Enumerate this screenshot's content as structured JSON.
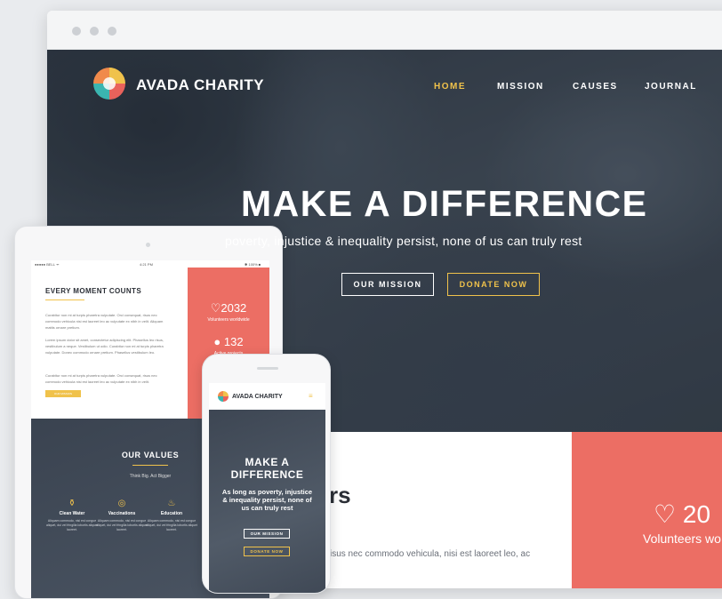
{
  "desktop": {
    "brand": "AVADA CHARITY",
    "nav": [
      "HOME",
      "MISSION",
      "CAUSES",
      "JOURNAL"
    ],
    "hero": {
      "title": "MAKE A DIFFERENCE",
      "subtitle": "poverty, injustice & inequality persist, none of us can truly rest",
      "btn_mission": "OUR MISSION",
      "btn_donate": "DONATE NOW"
    },
    "below": {
      "partial_heading": "rs",
      "partial_body": "isus nec commodo vehicula, nisi est laoreet leo, ac",
      "stat_value": "♡ 20",
      "stat_label": "Volunteers wo"
    }
  },
  "tablet": {
    "status_left": "●●●●● BELL ᯤ",
    "status_time": "4:21 PM",
    "status_right": "✱ 100% ■",
    "section_title": "EVERY MOMENT COUNTS",
    "para1": "Curabitur non mi at turpis pharetra vulputate. Orci consequat, risus nec commodo vehicula nisi est laoreet leo ac vulputate ex nibh in velit. Aliquam mattis ornare pretium.",
    "para2": "Lorem ipsum dolor sit amet, consectetur adipiscing elit. Phasellus leo risus, vestibulum a neque. Vestibulum ut odio. Curabitur non mi at turpis pharetra vulputate. Donec commodo ornare pretium. Phasellus vestibulum leo.",
    "para3": "Curabitur non mi at turpis pharetra vulputate. Orci consequat, risus nec commodo vehicula nisi est laoreet leo ac vulputate ex nibh in velit.",
    "button": "OUR MISSION",
    "stat1_value": "♡2032",
    "stat1_label": "Volunteers worldwide",
    "stat2_value": "132",
    "stat2_label": "Active projects",
    "values_title": "OUR VALUES",
    "values_sub": "Think Big. Act Bigger",
    "values": [
      {
        "icon": "⚱",
        "label": "Clean Water",
        "text": "Aliquam commodo, nisi est congue aliquet, dui vel fringilla lobortis aliquet laoreet."
      },
      {
        "icon": "◎",
        "label": "Vaccinations",
        "text": "Aliquam commodo, nisi est congue aliquet, dui vel fringilla lobortis aliquet laoreet."
      },
      {
        "icon": "♨",
        "label": "Education",
        "text": "Aliquam commodo, nisi est congue aliquet, dui vel fringilla lobortis aliquet laoreet."
      }
    ]
  },
  "phone": {
    "brand": "AVADA CHARITY",
    "menu_icon": "≡",
    "hero_title": "MAKE A DIFFERENCE",
    "hero_sub": "As long as poverty, injustice & inequality persist, none of us can truly rest",
    "btn_mission": "OUR MISSION",
    "btn_donate": "DONATE NOW"
  },
  "colors": {
    "accent_gold": "#f0c24b",
    "accent_red": "#ec6e64",
    "hero_dark": "#3b4450"
  }
}
